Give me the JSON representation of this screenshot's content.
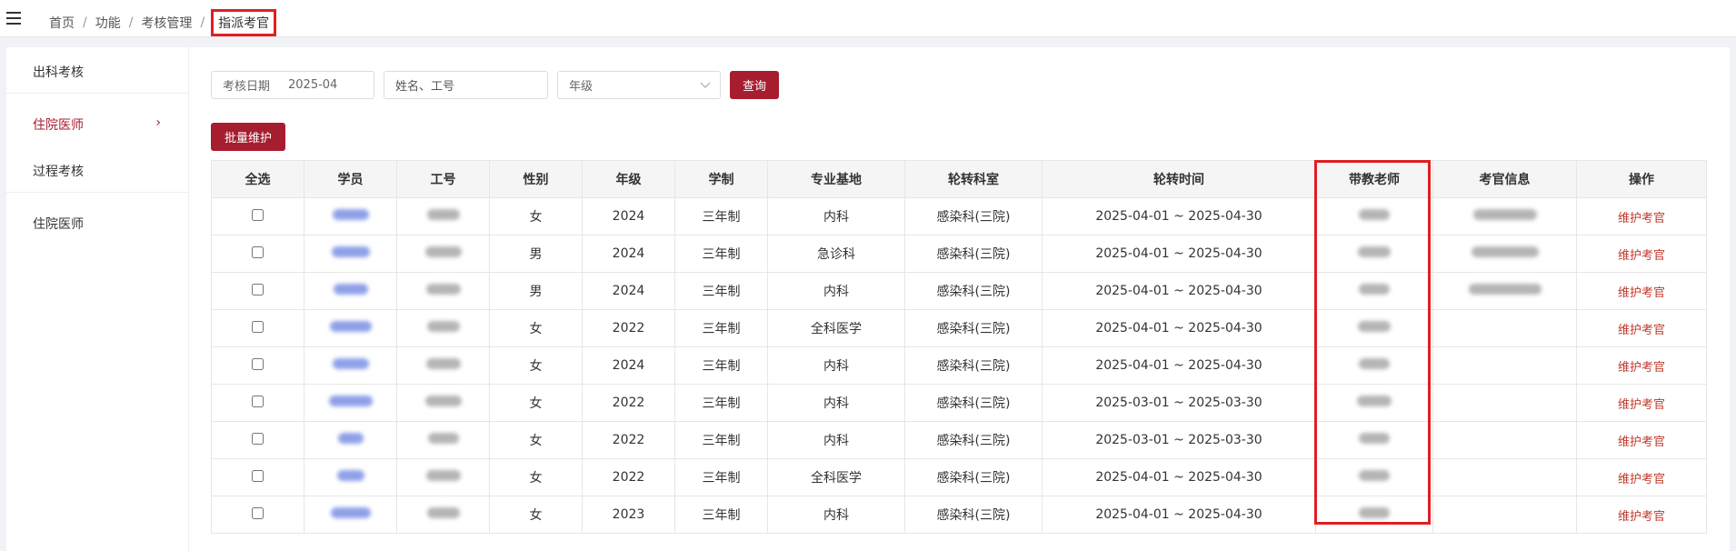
{
  "breadcrumb": [
    "首页",
    "功能",
    "考核管理",
    "指派考官"
  ],
  "sidebar": {
    "items": [
      {
        "label": "出科考核"
      },
      {
        "label": "住院医师",
        "arrow": "›"
      },
      {
        "label": "过程考核"
      },
      {
        "label": "住院医师"
      }
    ]
  },
  "filters": {
    "date_label": "考核日期",
    "date_value": "2025-04",
    "name_placeholder": "姓名、工号",
    "grade_placeholder": "年级",
    "query_label": "查询"
  },
  "batch_label": "批量维护",
  "table": {
    "headers": [
      "全选",
      "学员",
      "工号",
      "性别",
      "年级",
      "学制",
      "专业基地",
      "轮转科室",
      "轮转时间",
      "带教老师",
      "考官信息",
      "操作"
    ],
    "rows": [
      {
        "gender": "女",
        "grade": "2024",
        "system": "三年制",
        "base": "内科",
        "dept": "感染科(三院)",
        "period": "2025-04-01 ~ 2025-04-30",
        "has_examiner": true,
        "action": "维护考官"
      },
      {
        "gender": "男",
        "grade": "2024",
        "system": "三年制",
        "base": "急诊科",
        "dept": "感染科(三院)",
        "period": "2025-04-01 ~ 2025-04-30",
        "has_examiner": true,
        "action": "维护考官"
      },
      {
        "gender": "男",
        "grade": "2024",
        "system": "三年制",
        "base": "内科",
        "dept": "感染科(三院)",
        "period": "2025-04-01 ~ 2025-04-30",
        "has_examiner": true,
        "action": "维护考官"
      },
      {
        "gender": "女",
        "grade": "2022",
        "system": "三年制",
        "base": "全科医学",
        "dept": "感染科(三院)",
        "period": "2025-04-01 ~ 2025-04-30",
        "has_examiner": false,
        "action": "维护考官"
      },
      {
        "gender": "女",
        "grade": "2024",
        "system": "三年制",
        "base": "内科",
        "dept": "感染科(三院)",
        "period": "2025-04-01 ~ 2025-04-30",
        "has_examiner": false,
        "action": "维护考官"
      },
      {
        "gender": "女",
        "grade": "2022",
        "system": "三年制",
        "base": "内科",
        "dept": "感染科(三院)",
        "period": "2025-03-01 ~ 2025-03-30",
        "has_examiner": false,
        "action": "维护考官"
      },
      {
        "gender": "女",
        "grade": "2022",
        "system": "三年制",
        "base": "内科",
        "dept": "感染科(三院)",
        "period": "2025-03-01 ~ 2025-03-30",
        "has_examiner": false,
        "action": "维护考官"
      },
      {
        "gender": "女",
        "grade": "2022",
        "system": "三年制",
        "base": "全科医学",
        "dept": "感染科(三院)",
        "period": "2025-04-01 ~ 2025-04-30",
        "has_examiner": false,
        "action": "维护考官"
      },
      {
        "gender": "女",
        "grade": "2023",
        "system": "三年制",
        "base": "内科",
        "dept": "感染科(三院)",
        "period": "2025-04-01 ~ 2025-04-30",
        "has_examiner": false,
        "action": "维护考官"
      }
    ]
  },
  "colors": {
    "accent": "#a61d2f",
    "highlight": "#e01e24",
    "link": "#c0392b"
  }
}
